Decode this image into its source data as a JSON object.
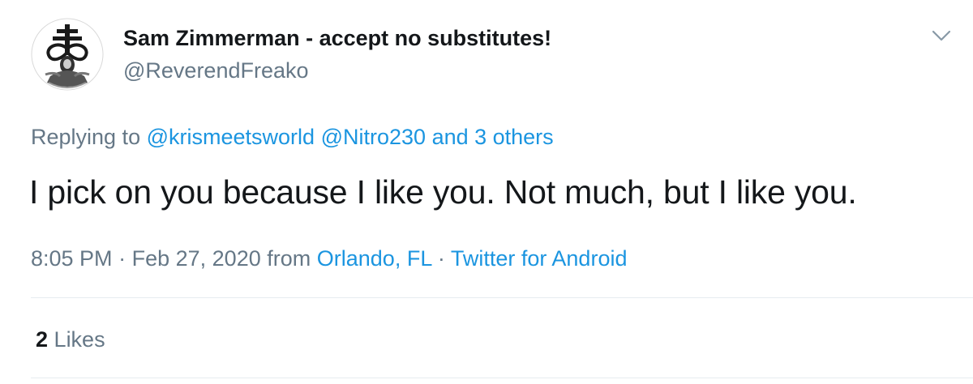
{
  "author": {
    "display_name": "Sam Zimmerman - accept no substitutes!",
    "handle": "@ReverendFreako",
    "avatar_icon": "cross-emblem-avatar"
  },
  "menu": {
    "icon": "chevron-down-icon"
  },
  "reply": {
    "prefix": "Replying to",
    "mentions": [
      "@krismeetsworld",
      "@Nitro230"
    ],
    "others": "and 3 others"
  },
  "tweet": {
    "text": "I pick on you because I like you. Not much, but I like you."
  },
  "meta": {
    "time": "8:05 PM",
    "separator": "·",
    "date": "Feb 27, 2020",
    "from_label": "from",
    "location": "Orlando, FL",
    "source": "Twitter for Android"
  },
  "stats": {
    "likes_count": "2",
    "likes_label": "Likes"
  },
  "colors": {
    "link": "#1b95e0",
    "secondary_text": "#657786",
    "primary_text": "#14171a",
    "divider": "#e6ecf0"
  }
}
